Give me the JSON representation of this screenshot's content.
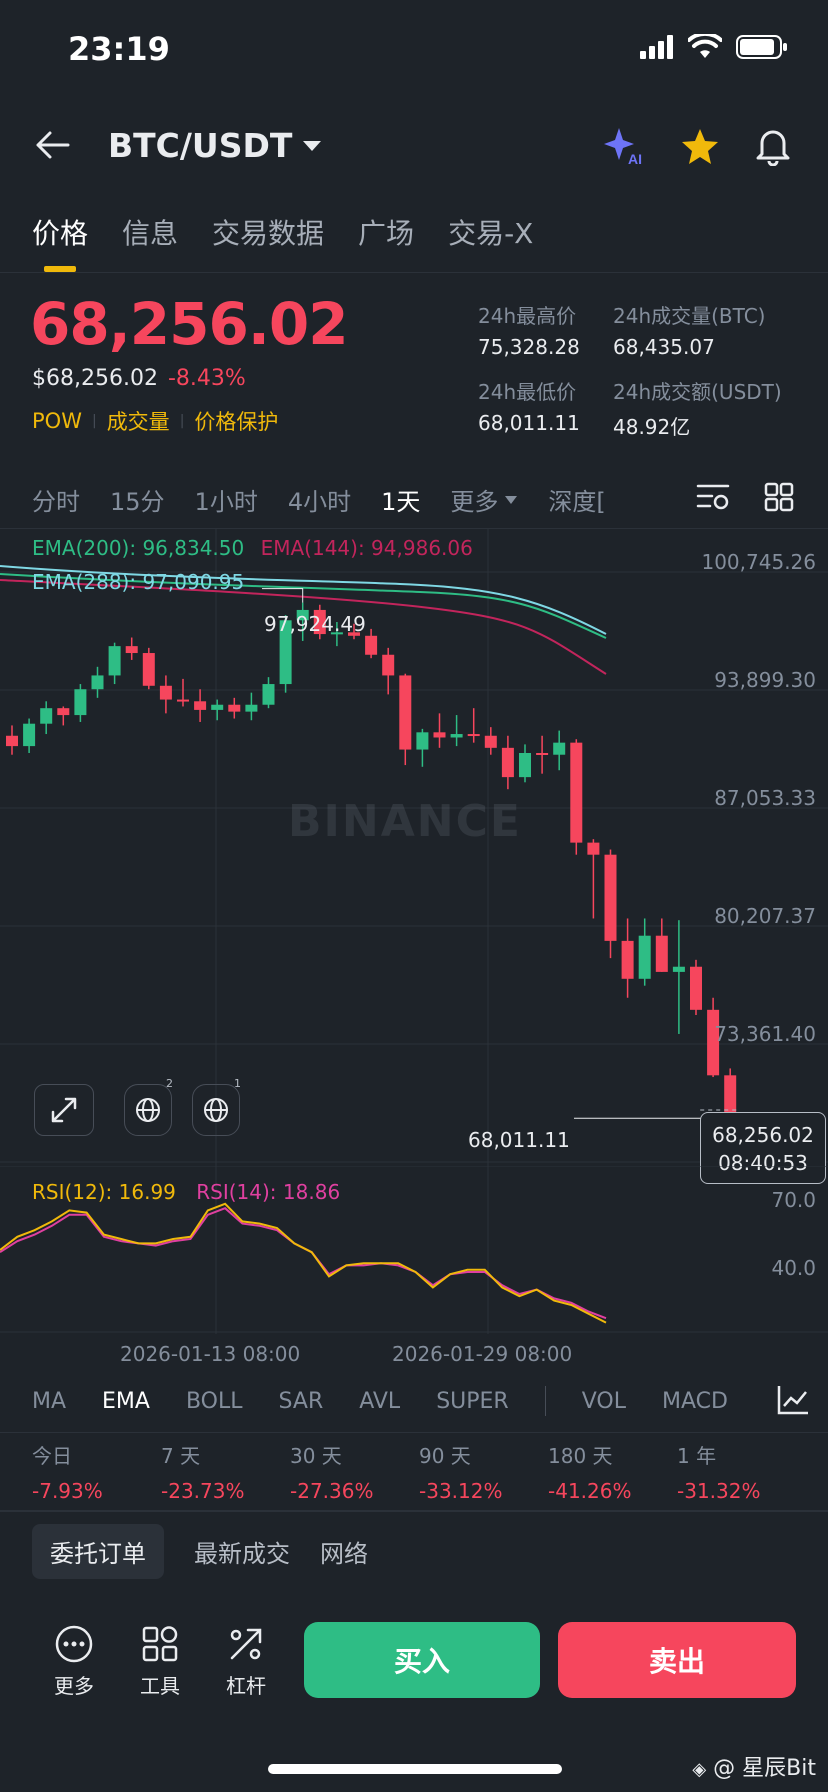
{
  "status": {
    "time": "23:19"
  },
  "header": {
    "pair": "BTC/USDT"
  },
  "tabs": [
    "价格",
    "信息",
    "交易数据",
    "广场",
    "交易-X"
  ],
  "price": {
    "last": "68,256.02",
    "usd": "$68,256.02",
    "change": "-8.43%",
    "tags": [
      "POW",
      "成交量",
      "价格保护"
    ]
  },
  "stats": {
    "high_label": "24h最高价",
    "high": "75,328.28",
    "vol_btc_label": "24h成交量(BTC)",
    "vol_btc": "68,435.07",
    "low_label": "24h最低价",
    "low": "68,011.11",
    "vol_usdt_label": "24h成交额(USDT)",
    "vol_usdt": "48.92亿"
  },
  "intervals": [
    "分时",
    "15分",
    "1小时",
    "4小时",
    "1天",
    "更多",
    "深度["
  ],
  "ema_legend": {
    "ema200": "EMA(200): 96,834.50",
    "ema144": "EMA(144): 94,986.06",
    "ema288": "EMA(288): 97,090.95"
  },
  "price_axis": [
    "100,745.26",
    "93,899.30",
    "87,053.33",
    "80,207.37",
    "73,361.40"
  ],
  "annotations": {
    "high_mark": "97,924.49",
    "low_mark": "68,011.11",
    "current_price": "68,256.02",
    "countdown": "08:40:53"
  },
  "watermark": "BINANCE",
  "chart_tools": {
    "badge_a": "2",
    "badge_b": "1"
  },
  "rsi": {
    "rsi12": "RSI(12): 16.99",
    "rsi14": "RSI(14): 18.86",
    "axis_high": "70.0",
    "axis_low": "40.0"
  },
  "dates": [
    "2026-01-13 08:00",
    "2026-01-29 08:00"
  ],
  "indicators": [
    "MA",
    "EMA",
    "BOLL",
    "SAR",
    "AVL",
    "SUPER",
    "VOL",
    "MACD"
  ],
  "performance": [
    {
      "label": "今日",
      "value": "-7.93%"
    },
    {
      "label": "7 天",
      "value": "-23.73%"
    },
    {
      "label": "30 天",
      "value": "-27.36%"
    },
    {
      "label": "90 天",
      "value": "-33.12%"
    },
    {
      "label": "180 天",
      "value": "-41.26%"
    },
    {
      "label": "1 年",
      "value": "-31.32%"
    }
  ],
  "order_tabs": [
    "委托订单",
    "最新成交",
    "网络"
  ],
  "bottom": {
    "more": "更多",
    "tools": "工具",
    "leverage": "杠杆",
    "buy": "买入",
    "sell": "卖出"
  },
  "credit": "@ 星辰Bit",
  "colors": {
    "up": "#2ebd85",
    "down": "#f6465d",
    "accent": "#f0b90b",
    "bg": "#1e2329"
  },
  "candles": [
    [
      90200,
      90800,
      89100,
      89600
    ],
    [
      89600,
      91200,
      89200,
      90900
    ],
    [
      90900,
      92200,
      90300,
      91800
    ],
    [
      91800,
      91900,
      90800,
      91400
    ],
    [
      91400,
      93200,
      91000,
      92900
    ],
    [
      92900,
      94200,
      92400,
      93700
    ],
    [
      93700,
      95600,
      93200,
      95400
    ],
    [
      95400,
      95900,
      94600,
      95000
    ],
    [
      95000,
      95300,
      92900,
      93100
    ],
    [
      93100,
      93700,
      91500,
      92300
    ],
    [
      92300,
      93500,
      91900,
      92200
    ],
    [
      92200,
      92900,
      91000,
      91700
    ],
    [
      91700,
      92300,
      91100,
      92000
    ],
    [
      92000,
      92400,
      91200,
      91600
    ],
    [
      91600,
      92700,
      91100,
      92000
    ],
    [
      92000,
      93600,
      91800,
      93200
    ],
    [
      93200,
      97200,
      92700,
      96900
    ],
    [
      96900,
      97924.49,
      95700,
      97500
    ],
    [
      97500,
      97800,
      95800,
      96100
    ],
    [
      96100,
      96800,
      95400,
      96200
    ],
    [
      96200,
      96700,
      95800,
      96000
    ],
    [
      96000,
      96400,
      94700,
      94900
    ],
    [
      94900,
      95300,
      92600,
      93700
    ],
    [
      93700,
      93800,
      88500,
      89400
    ],
    [
      89400,
      90600,
      88400,
      90400
    ],
    [
      90400,
      91500,
      89500,
      90100
    ],
    [
      90100,
      91400,
      89600,
      90300
    ],
    [
      90300,
      91800,
      89800,
      90200
    ],
    [
      90200,
      90700,
      89100,
      89500
    ],
    [
      89500,
      90200,
      87100,
      87800
    ],
    [
      87800,
      89700,
      87500,
      89200
    ],
    [
      89200,
      90200,
      88000,
      89100
    ],
    [
      89100,
      90500,
      88200,
      89800
    ],
    [
      89800,
      90000,
      83300,
      84000
    ],
    [
      84000,
      84200,
      79600,
      83300
    ],
    [
      83300,
      83600,
      77300,
      78300
    ],
    [
      78300,
      79600,
      75000,
      76100
    ],
    [
      76100,
      79600,
      75700,
      78600
    ],
    [
      78600,
      79600,
      76500,
      76500
    ],
    [
      76500,
      79500,
      72900,
      76800
    ],
    [
      76800,
      77200,
      74000,
      74300
    ],
    [
      74300,
      75000,
      70400,
      70500
    ],
    [
      70500,
      70900,
      68011.11,
      68256.02
    ]
  ],
  "rsi_series": {
    "rsi12": [
      50,
      56,
      59,
      63,
      68,
      67,
      57,
      55,
      53,
      53,
      55,
      56,
      68,
      71,
      63,
      62,
      60,
      53,
      49,
      38,
      43,
      44,
      44,
      44,
      40,
      33,
      39,
      41,
      41,
      33,
      29,
      32,
      27,
      25,
      21,
      17
    ],
    "rsi14": [
      49,
      54,
      57,
      61,
      66,
      66,
      56,
      54,
      53,
      52,
      54,
      55,
      66,
      69,
      62,
      61,
      59,
      53,
      49,
      39,
      43,
      43,
      44,
      43,
      40,
      34,
      39,
      40,
      40,
      34,
      30,
      32,
      28,
      26,
      22,
      19
    ]
  }
}
